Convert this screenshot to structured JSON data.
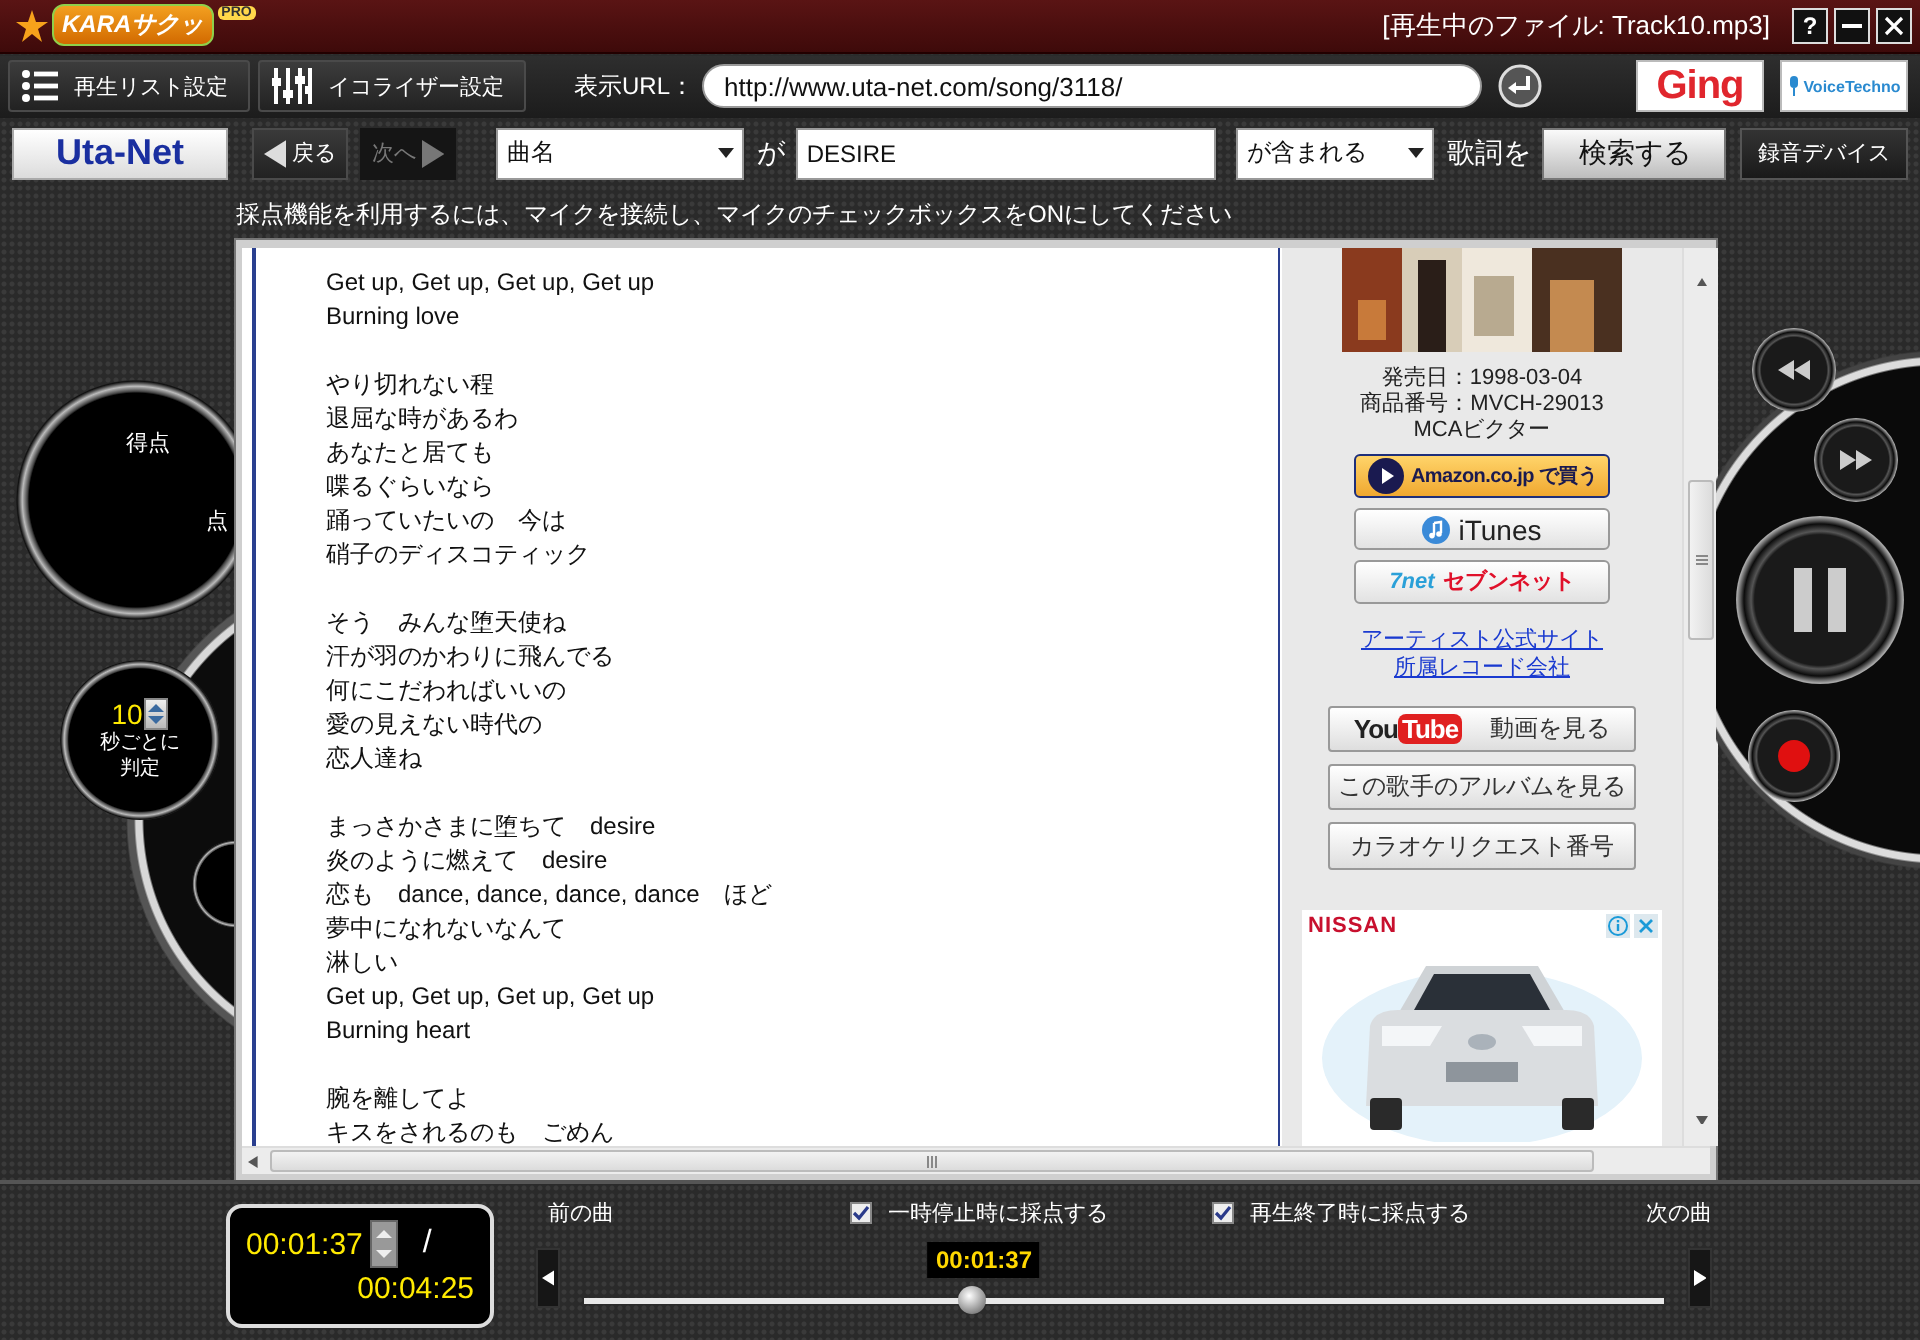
{
  "title_bar": {
    "logo": "KARAサクッ",
    "logo_badge": "PRO",
    "now_playing": "[再生中のファイル: Track10.mp3]",
    "buttons": [
      {
        "kind": "help",
        "label": "?"
      },
      {
        "kind": "minimize"
      },
      {
        "kind": "close"
      }
    ]
  },
  "toolbar": {
    "buttons": [
      {
        "kind": "list",
        "label": "再生リスト設定"
      },
      {
        "kind": "equalizer",
        "label": "イコライザー設定"
      }
    ],
    "url_label": "表示URL：",
    "url": "http://www.uta-net.com/song/3118/",
    "partner_logos": [
      {
        "kind": "ging",
        "label": "Ging"
      },
      {
        "kind": "voice",
        "label": "VoiceTechno"
      }
    ]
  },
  "search": {
    "site_logo": "Uta-Net",
    "back": {
      "label": "戻る",
      "disabled": false
    },
    "forward": {
      "label": "次へ",
      "disabled": true
    },
    "field_select": "曲名",
    "particle": "が",
    "query": "DESIRE",
    "match_select": "が含まれる",
    "suffix": "歌詞を",
    "submit": "検索する",
    "device_button": "録音デバイス"
  },
  "notice": "採点機能を利用するには、マイクを接続し、マイクのチェックボックスをONにしてください",
  "score_panel": {
    "score_label": "得点",
    "unit": "点",
    "interval": "10",
    "interval_label": [
      "秒ごとに",
      "判定"
    ]
  },
  "lyrics": {
    "stanzas": [
      [
        "Get up, Get up, Get up, Get up",
        "Burning love"
      ],
      [
        "やり切れない程",
        "退屈な時があるわ",
        "あなたと居ても",
        "喋るぐらいなら",
        "踊っていたいの　今は",
        "硝子のディスコティック"
      ],
      [
        "そう　みんな堕天使ね",
        "汗が羽のかわりに飛んでる",
        "何にこだわればいいの",
        "愛の見えない時代の",
        "恋人達ね"
      ],
      [
        "まっさかさまに堕ちて　desire",
        "炎のように燃えて　desire",
        "恋も　dance, dance, dance, dance　ほど",
        "夢中になれないなんて",
        "淋しい",
        "Get up, Get up, Get up, Get up",
        "Burning heart"
      ],
      [
        "腕を離してよ",
        "キスをされるのも　ごめん"
      ]
    ]
  },
  "sidebar": {
    "album_art": {
      "kind": "picture"
    },
    "release_date": "発売日：1998-03-04",
    "catalog_no": "商品番号：MVCH-29013",
    "record_label": "MCAビクター",
    "store_buttons": [
      {
        "kind": "amazon",
        "label": "Amazon.co.jp で買う"
      },
      {
        "kind": "itunes",
        "label": "iTunes"
      },
      {
        "kind": "sevennet",
        "logo": "7net",
        "label": "セブンネット"
      }
    ],
    "links": [
      "アーティスト公式サイト",
      "所属レコード会社"
    ],
    "buttons": [
      {
        "kind": "youtube",
        "logo": [
          "You",
          "Tube"
        ],
        "label": "動画を見る"
      },
      {
        "kind": "plain",
        "label": "この歌手のアルバムを見る"
      },
      {
        "kind": "plain",
        "label": "カラオケリクエスト番号"
      }
    ],
    "ad": {
      "brand": "NISSAN"
    }
  },
  "player_controls": [
    {
      "kind": "rewind"
    },
    {
      "kind": "fast_forward"
    },
    {
      "kind": "pause"
    },
    {
      "kind": "record"
    }
  ],
  "bottom": {
    "elapsed": "00:01:37",
    "separator": "/",
    "total": "00:04:25",
    "prev_label": "前の曲",
    "next_label": "次の曲",
    "options": [
      {
        "label": "一時停止時に採点する",
        "checked": true
      },
      {
        "label": "再生終了時に採点する",
        "checked": true
      }
    ],
    "position_time": "00:01:37",
    "seek": {
      "level": 0.36
    }
  }
}
